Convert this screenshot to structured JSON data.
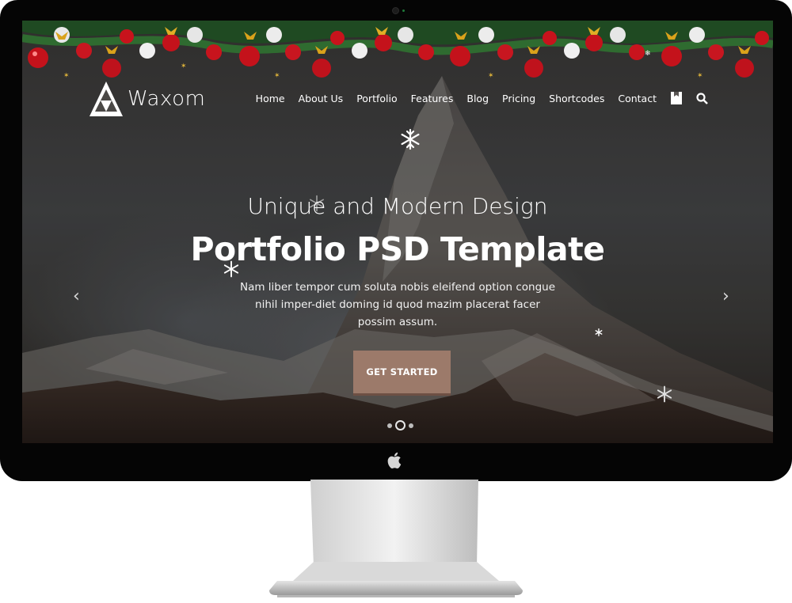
{
  "brand": {
    "logo_text": "Waxom"
  },
  "nav": {
    "items": [
      {
        "label": "Home"
      },
      {
        "label": "About Us"
      },
      {
        "label": "Portfolio"
      },
      {
        "label": "Features"
      },
      {
        "label": "Blog"
      },
      {
        "label": "Pricing"
      },
      {
        "label": "Shortcodes"
      },
      {
        "label": "Contact"
      }
    ],
    "icons": [
      "bookmark-icon",
      "search-icon"
    ]
  },
  "hero": {
    "subtitle": "Unique and Modern Design",
    "title": "Portfolio PSD Template",
    "description": "Nam liber tempor cum soluta nobis eleifend option congue nihil imper-diet doming id quod mazim placerat facer possim assum.",
    "cta_label": "GET STARTED",
    "prev_arrow": "‹",
    "next_arrow": "›",
    "slides_count": 3,
    "active_slide": 2
  },
  "colors": {
    "cta": "#9c7a6a",
    "text": "#ffffff",
    "bezel": "#050505"
  },
  "decor": {
    "garland": "christmas-garland",
    "snowflakes": "snowflake-icon",
    "device_logo": "apple-logo-icon"
  }
}
